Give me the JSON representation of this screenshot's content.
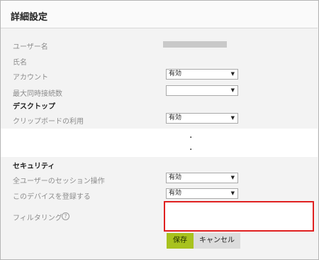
{
  "page": {
    "title": "詳細設定"
  },
  "fields": {
    "username_label": "ユーザー名",
    "fullname_label": "氏名",
    "account_label": "アカウント",
    "account_value": "有効",
    "max_conn_label": "最大同時接続数",
    "max_conn_value": ""
  },
  "desktop": {
    "heading": "デスクトップ",
    "clipboard_label": "クリップボードの利用",
    "clipboard_value": "有効"
  },
  "security": {
    "heading": "セキュリティ",
    "all_users_session_label": "全ユーザーのセッション操作",
    "all_users_session_value": "有効",
    "register_device_label": "このデバイスを登録する",
    "register_device_value": "有効",
    "filtering_label": "フィルタリング",
    "filtering_value": ""
  },
  "buttons": {
    "save": "保存",
    "cancel": "キャンセル"
  },
  "icons": {
    "dropdown": "chevron-down-icon",
    "help": "info-icon"
  },
  "colors": {
    "save_button": "#a8c21e",
    "highlight_border": "#e02020"
  }
}
